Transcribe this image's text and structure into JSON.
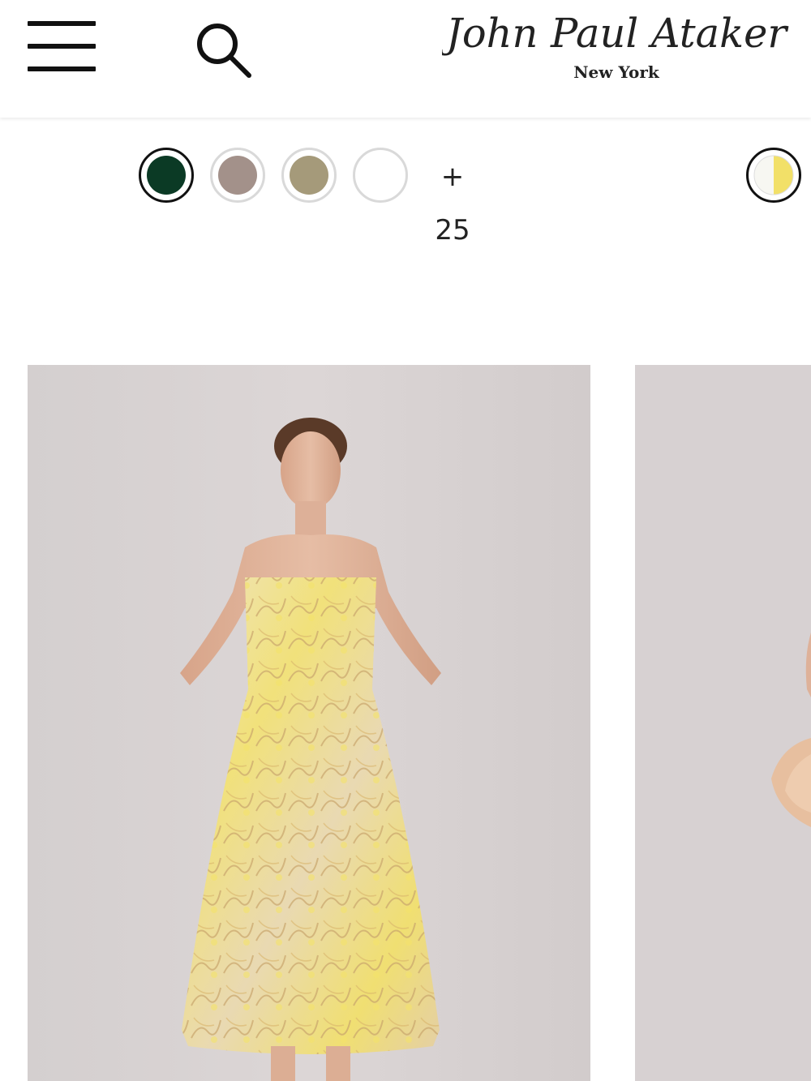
{
  "header": {
    "menu_icon": "hamburger-menu-icon",
    "search_icon": "search-icon",
    "logo_script": "John Paul Ataker",
    "logo_subtitle": "New York"
  },
  "swatches": {
    "items": [
      {
        "name": "dark-green",
        "color": "#0b3a25",
        "selected": true
      },
      {
        "name": "taupe",
        "color": "#a3918a",
        "selected": false
      },
      {
        "name": "khaki",
        "color": "#a59a7a",
        "selected": false
      },
      {
        "name": "white",
        "color": "#ffffff",
        "selected": false
      }
    ],
    "more_plus": "+",
    "more_count": "25",
    "next_product_swatch": {
      "colors": [
        "#ffffff",
        "#f2e068"
      ],
      "selected": true
    }
  },
  "products": [
    {
      "image_alt": "Yellow strapless jacquard midi dress",
      "background": "#d6d0d0",
      "dress_color": "#f0e07a"
    },
    {
      "image_alt": "Peach dress",
      "background": "#d7d1d2",
      "dress_color": "#e7bf9f"
    }
  ]
}
